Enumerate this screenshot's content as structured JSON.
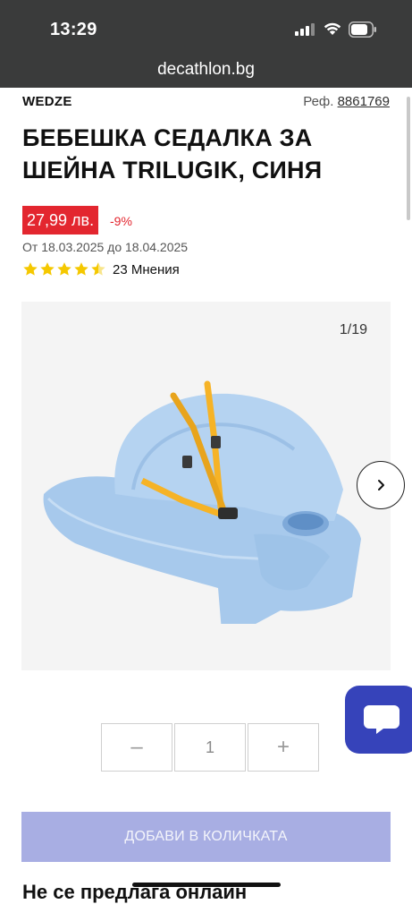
{
  "status_bar": {
    "time": "13:29"
  },
  "browser": {
    "url": "decathlon.bg"
  },
  "product": {
    "brand": "WEDZE",
    "ref_label": "Реф.",
    "ref_number": "8861769",
    "title": "БЕБЕШКА СЕДАЛКА ЗА ШЕЙНА TRILUGIK, СИНЯ",
    "price": "27,99 лв.",
    "discount": "-9%",
    "promo_dates": "От 18.03.2025 до 18.04.2025",
    "rating": 4.5,
    "reviews": "23 Мнения"
  },
  "gallery": {
    "counter": "1/19"
  },
  "quantity": {
    "minus": "–",
    "value": "1",
    "plus": "+"
  },
  "actions": {
    "add_to_cart": "ДОБАВИ В КОЛИЧКАТА"
  },
  "footer_text": "Не се предлага онлайн",
  "colors": {
    "sale_red": "#e3262f",
    "brand_blue": "#3643ba",
    "disabled_button": "#a8aee3",
    "topbar": "#3a3b3b"
  }
}
